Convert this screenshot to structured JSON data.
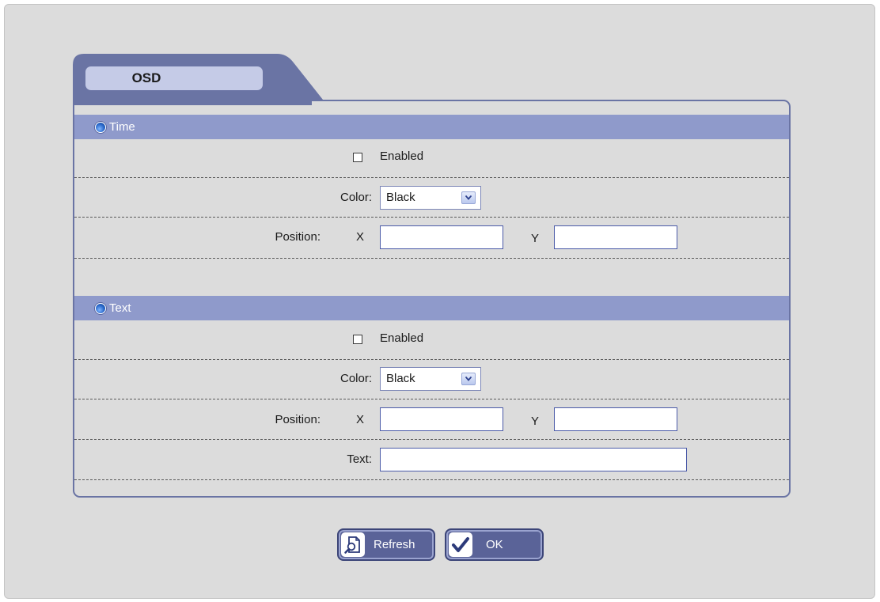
{
  "tab": {
    "label": "OSD"
  },
  "time_section": {
    "header": "Time",
    "enabled_label": "Enabled",
    "enabled_checked": false,
    "color_label": "Color:",
    "color_value": "Black",
    "position_label": "Position:",
    "x_label": "X",
    "x_value": "",
    "y_label": "Y",
    "y_value": ""
  },
  "text_section": {
    "header": "Text",
    "enabled_label": "Enabled",
    "enabled_checked": false,
    "color_label": "Color:",
    "color_value": "Black",
    "position_label": "Position:",
    "x_label": "X",
    "x_value": "",
    "y_label": "Y",
    "y_value": "",
    "text_label": "Text:",
    "text_value": ""
  },
  "buttons": {
    "refresh_label": "Refresh",
    "ok_label": "OK"
  },
  "icons": {
    "section_bullet": "blue-sphere-icon",
    "select_arrow": "chevron-down-icon",
    "refresh": "refresh-document-icon",
    "ok": "checkmark-icon"
  },
  "colors": {
    "tab": "#6a74a4",
    "section_header": "#8f9acb",
    "tab_label_bg": "#c5cbe7",
    "button": "#5a6398",
    "background": "#dcdcdc"
  }
}
